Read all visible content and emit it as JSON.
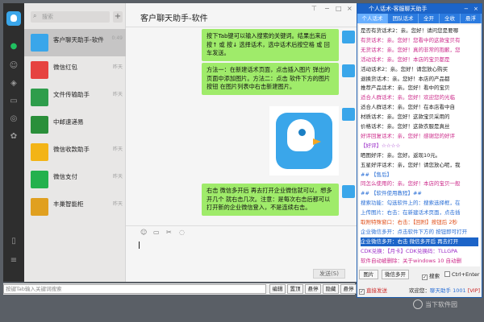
{
  "search": {
    "placeholder": "搜索"
  },
  "contacts": [
    {
      "name": "客户聊天助手-软件",
      "time": "0:49",
      "color": "#3aa6ea"
    },
    {
      "name": "微信红包",
      "time": "昨天",
      "color": "#e64340"
    },
    {
      "name": "文件传输助手",
      "time": "昨天",
      "color": "#2e9d4b"
    },
    {
      "name": "中邮速递易",
      "time": "",
      "color": "#2a8f3a"
    },
    {
      "name": "微信收款助手",
      "time": "昨天",
      "color": "#f3b416"
    },
    {
      "name": "微信支付",
      "time": "昨天",
      "color": "#23b14d"
    },
    {
      "name": "丰巢智能柜",
      "time": "昨天",
      "color": "#e0a020"
    }
  ],
  "chat": {
    "title": "客户聊天助手-软件",
    "messages": [
      "按下Tab键可以输入搜索的关键词。结果出来后 按↑ 或 按↓ 选择话术，选中话术后按空格 或 回车发送。",
      "方法一：在新建话术页面，点击插入图片 弹出的页面中添加图片。方法二：点击 软件下方的图片按钮 在图片列表中右击新建图片。",
      "右击 微信多开后 再去打开企业微信就可以，想多开几个 就右击几次。注意：是每次右击后都可以打开新的企业微信登入，不是连续右击。"
    ],
    "send_label": "发送(S)"
  },
  "helper": {
    "title": "个人话术-客服聊天助手",
    "tabs": [
      "个人话术",
      "团队话术",
      "全开",
      "全收",
      "悬浮"
    ],
    "rows": [
      {
        "text": "是否有货话术2：亲。您好！请问您是要哪",
        "color": "#222222",
        "selected": false
      },
      {
        "text": "有货话术：亲。您好！您看中的这款宝贝有",
        "color": "#cc2a8a",
        "selected": false
      },
      {
        "text": "无货话术：亲。您好！真的非常的抱歉，您",
        "color": "#cc2a8a",
        "selected": false
      },
      {
        "text": "活动话术：亲。您好！本店的宝贝都是",
        "color": "#cc2a8a",
        "selected": false
      },
      {
        "text": "活动话术2：亲。您好！请您放心购买",
        "color": "#222222",
        "selected": false
      },
      {
        "text": "退换货话术：亲。您好！本店的产品都",
        "color": "#222222",
        "selected": false
      },
      {
        "text": "推荐产品话术：亲。您好！看中的宝贝",
        "color": "#222222",
        "selected": false
      },
      {
        "text": "适合人群话术：亲。您好！欢迎您的光临",
        "color": "#cc2a8a",
        "selected": false
      },
      {
        "text": "适合人群话术：亲。您好！在本店看中自",
        "color": "#222222",
        "selected": false
      },
      {
        "text": "材质话术：亲。您好！这款宝贝采用的",
        "color": "#222222",
        "selected": false
      },
      {
        "text": "价格话术：亲。您好！这款衣服是真丝",
        "color": "#222222",
        "selected": false
      },
      {
        "text": "好评回复话术：亲，您好！感谢您的好评",
        "color": "#cc2a8a",
        "selected": false
      },
      {
        "text": "【好评】☆☆☆☆",
        "color": "#9b2dc8",
        "selected": false
      },
      {
        "text": "晒图好评：亲。您好。返现10元。",
        "color": "#222222",
        "selected": false
      },
      {
        "text": "五星好评话术：亲，您好！请您放心呢，我",
        "color": "#222222",
        "selected": false
      },
      {
        "text": "## 【售后】",
        "color": "#2a6fd6",
        "selected": false
      },
      {
        "text": "同怎么使用的：亲。您好！本店的宝贝一般",
        "color": "#cc2a8a",
        "selected": false
      },
      {
        "text": "## 【软件使用教程】##",
        "color": "#2a6fd6",
        "selected": false
      },
      {
        "text": "搜索功能：勾选软件上的：搜索选择框，在",
        "color": "#2a6fd6",
        "selected": false
      },
      {
        "text": "上传图片：右击：在新建话术页面，点击插",
        "color": "#2a6fd6",
        "selected": false
      },
      {
        "text": "取附特殊窗口：右击：【回附】按钮后 2秒",
        "color": "#e0501a",
        "selected": false
      },
      {
        "text": "企业微信多开：点击软件下方的 按钮即可打开",
        "color": "#2a6fd6",
        "selected": false
      },
      {
        "text": "企业微信多开：右击 微信多开后 再去打开",
        "color": "#ffffff",
        "selected": true
      },
      {
        "text": "CDK兑换：【月卡】CDK兑换码：TLLGPA",
        "color": "#9b2dc8",
        "selected": false
      },
      {
        "text": "软件自动被删除：关于windows 10 自动删",
        "color": "#cc2a8a",
        "selected": false
      }
    ],
    "btn_image": "图片",
    "btn_multi": "微信多开",
    "chk_search": "搜索",
    "chk_ctrl": "Ctrl+Enter",
    "chk_direct": "直接发送",
    "welcome": "欢迎您：",
    "user": "聊天助手 1001",
    "vip": "[VIP]"
  },
  "bottom": {
    "placeholder": "按键Tab输入关键词搜索",
    "buttons": [
      "编辑",
      "置顶",
      "悬停",
      "隐藏",
      "悬停"
    ]
  },
  "watermark": "当下软件园"
}
